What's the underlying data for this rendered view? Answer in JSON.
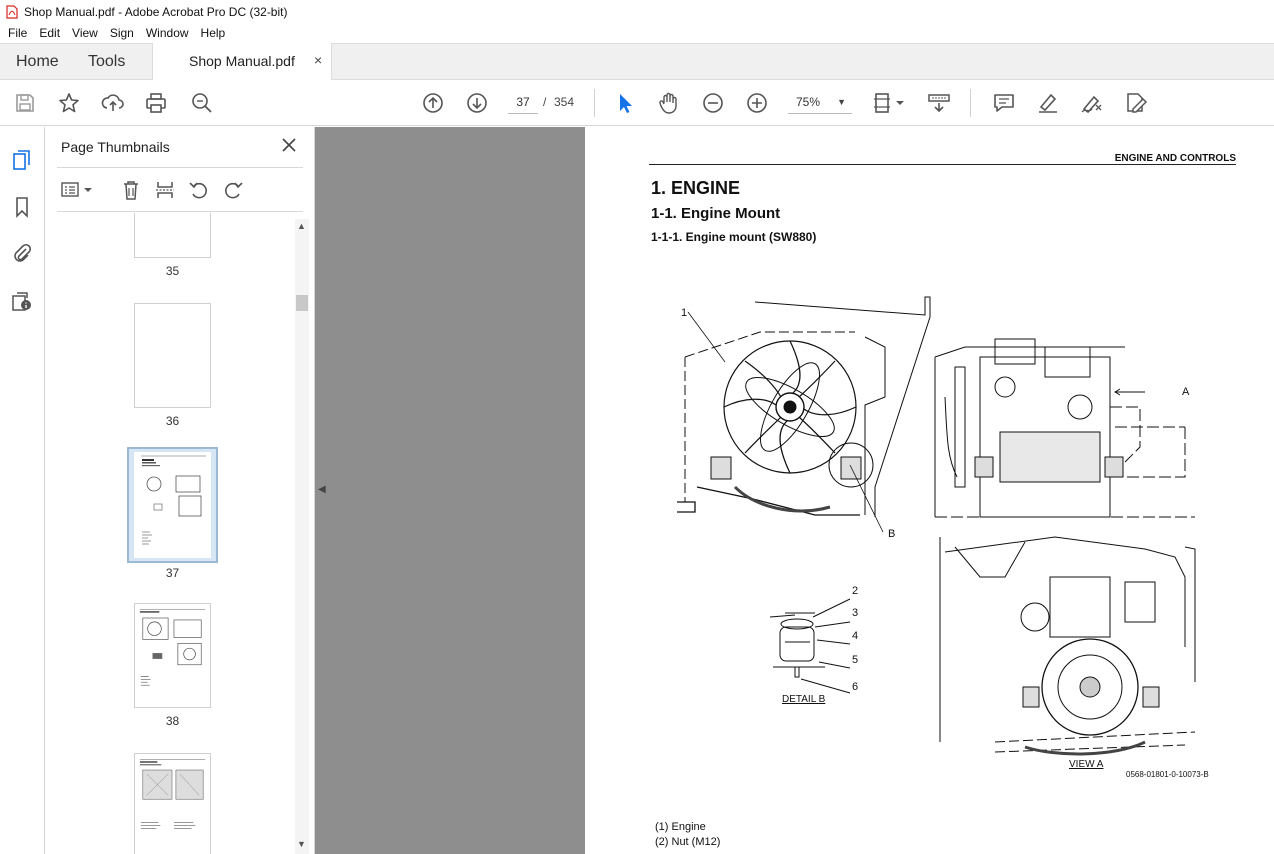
{
  "window": {
    "title": "Shop Manual.pdf - Adobe Acrobat Pro DC (32-bit)"
  },
  "menu": {
    "items": [
      "File",
      "Edit",
      "View",
      "Sign",
      "Window",
      "Help"
    ]
  },
  "tabs": {
    "home": "Home",
    "tools": "Tools",
    "document": "Shop Manual.pdf",
    "close": "×"
  },
  "toolbar": {
    "current_page": "37",
    "separator": "/",
    "total_pages": "354",
    "zoom": "75%",
    "icons": [
      "save-icon",
      "bookmark-star-icon",
      "upload-icon",
      "print-icon",
      "find-zoom-icon",
      "page-up-icon",
      "page-down-icon",
      "select-cursor-icon",
      "hand-icon",
      "zoom-out-icon",
      "zoom-in-icon",
      "page-fit-icon",
      "scroll-mode-icon",
      "comment-icon",
      "highlight-pen-icon",
      "draw-icon",
      "fill-sign-icon"
    ]
  },
  "left_rail": {
    "icons": [
      "page-thumbnails-icon",
      "bookmarks-icon",
      "attachments-icon",
      "accessibility-icon"
    ]
  },
  "thumbnail_panel": {
    "title": "Page Thumbnails",
    "pages": [
      {
        "label": "35"
      },
      {
        "label": "36"
      },
      {
        "label": "37"
      },
      {
        "label": "38"
      },
      {
        "label": ""
      }
    ]
  },
  "document": {
    "section_header": "ENGINE AND CONTROLS",
    "heading1": "1. ENGINE",
    "heading2": "1-1. Engine Mount",
    "heading3": "1-1-1. Engine mount (SW880)",
    "callouts": [
      "1",
      "A",
      "B",
      "2",
      "3",
      "4",
      "5",
      "6"
    ],
    "detail_b": "DETAIL B",
    "view_a": "VIEW A",
    "figure_code": "0568-01801-0-10073-B",
    "legend": [
      "(1) Engine",
      "(2) Nut (M12)"
    ]
  },
  "colors": {
    "acrobat_red": "#d7261e",
    "selection_blue": "#1473e6",
    "doc_background": "#8e8e8e"
  }
}
